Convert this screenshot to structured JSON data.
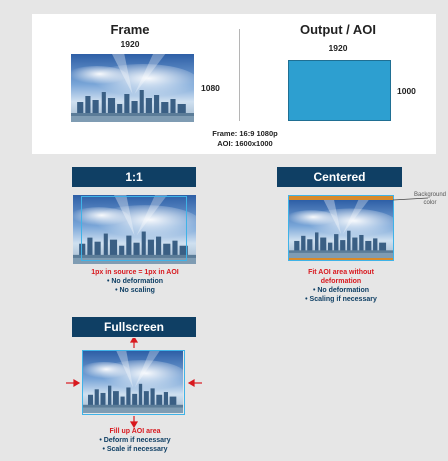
{
  "top": {
    "frame_title": "Frame",
    "frame_width": "1920",
    "frame_height": "1080",
    "output_title": "Output / AOI",
    "output_width": "1920",
    "output_height": "1000",
    "caption_line1": "Frame: 16:9 1080p",
    "caption_line2": "AOI: 1600x1000",
    "aoi_color": "#2d9fd0"
  },
  "one_to_one": {
    "title": "1:1",
    "line1": "1px in source = 1px in AOI",
    "bullet1": "• No deformation",
    "bullet2": "• No scaling"
  },
  "centered": {
    "title": "Centered",
    "bg_label": "Background color",
    "line1": "Fit AOI area without",
    "line2": "deformation",
    "bullet1": "• No deformation",
    "bullet2": "• Scaling if necessary"
  },
  "fullscreen": {
    "title": "Fullscreen",
    "line1": "Fill up AOI area",
    "bullet1": "• Deform if necessary",
    "bullet2": "• Scale if necessary"
  },
  "colors": {
    "banner": "#0f3f64",
    "aoi_outline": "#3fb3e8",
    "background_bar": "#d88a2a",
    "emphasis_red": "#d8191f"
  }
}
